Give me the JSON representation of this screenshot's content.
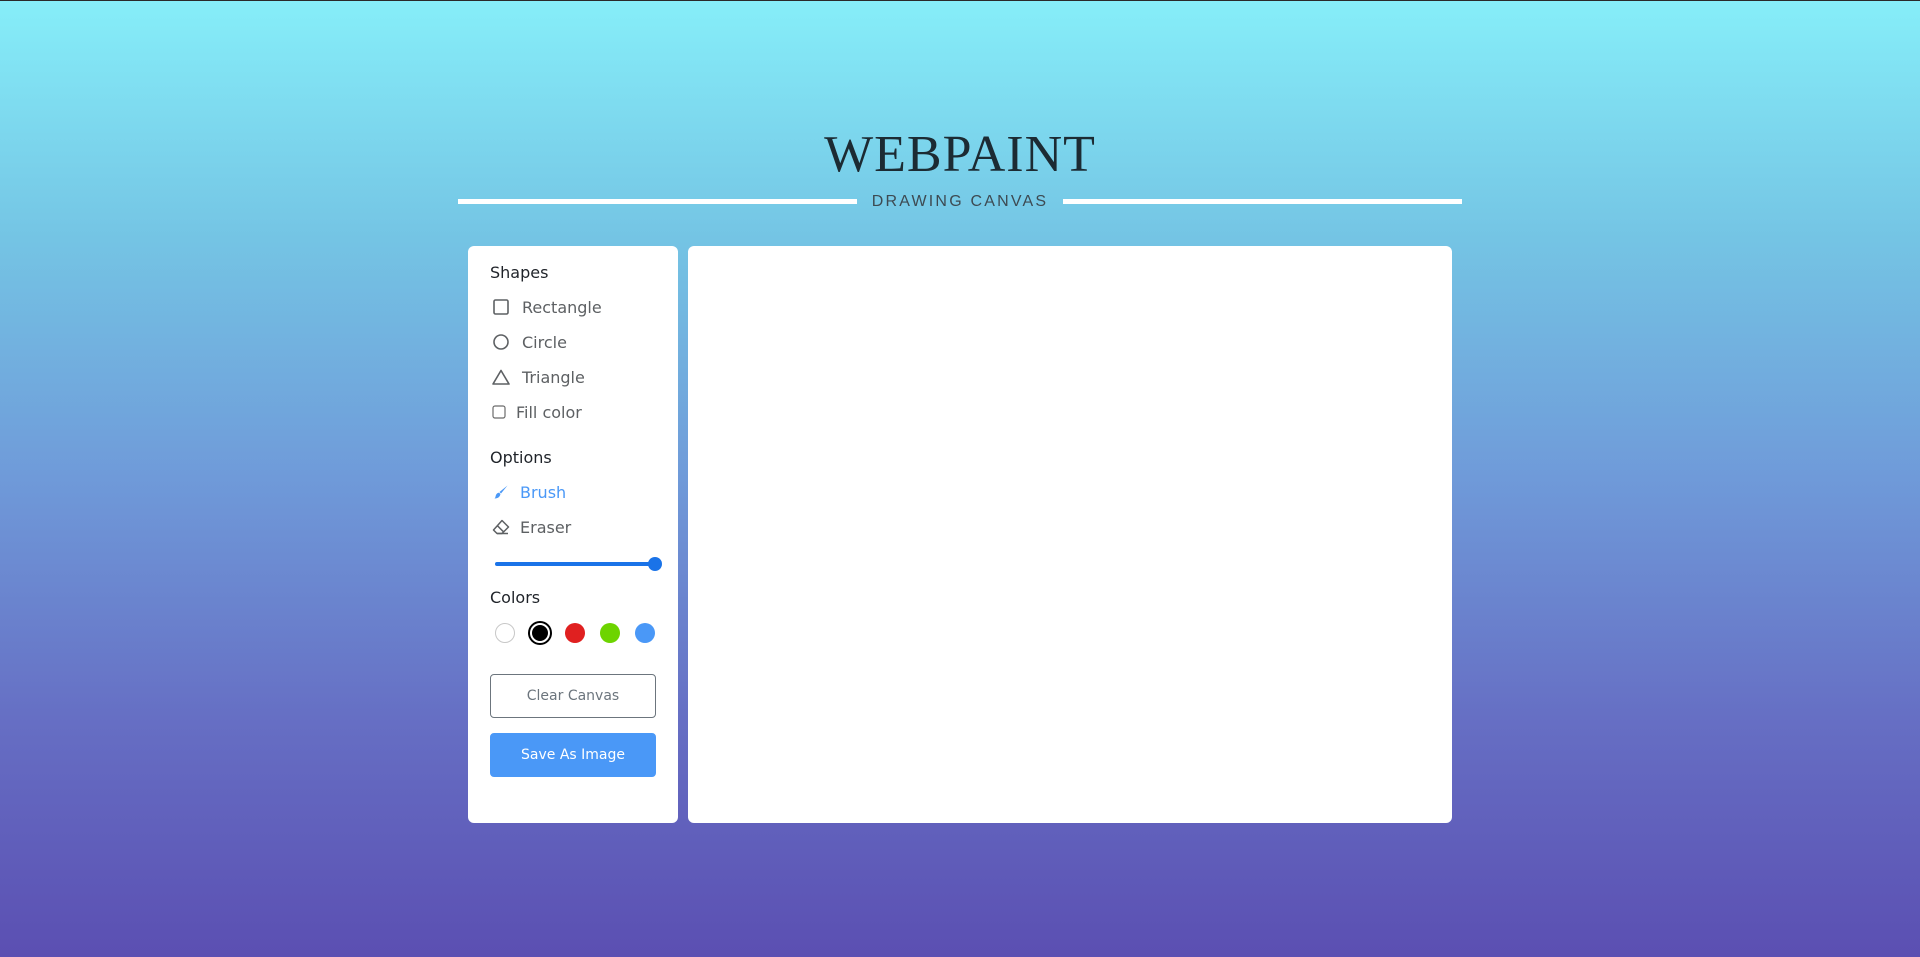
{
  "header": {
    "title": "WEBPAINT",
    "subtitle": "DRAWING CANVAS"
  },
  "toolbar": {
    "shapes": {
      "title": "Shapes",
      "items": [
        {
          "label": "Rectangle",
          "icon": "square-outline-icon"
        },
        {
          "label": "Circle",
          "icon": "circle-outline-icon"
        },
        {
          "label": "Triangle",
          "icon": "triangle-outline-icon"
        }
      ],
      "fill_label": "Fill color",
      "fill_checked": false
    },
    "options": {
      "title": "Options",
      "items": [
        {
          "label": "Brush",
          "icon": "brush-icon",
          "active": true
        },
        {
          "label": "Eraser",
          "icon": "eraser-icon",
          "active": false
        }
      ],
      "size_slider_value": 1.0
    },
    "colors": {
      "title": "Colors",
      "swatches": [
        "#ffffff",
        "#000000",
        "#e02020",
        "#6dd400",
        "#4a98f7"
      ],
      "selected_index": 1
    },
    "clear_label": "Clear Canvas",
    "save_label": "Save As Image"
  },
  "accent_color": "#4a98f7"
}
